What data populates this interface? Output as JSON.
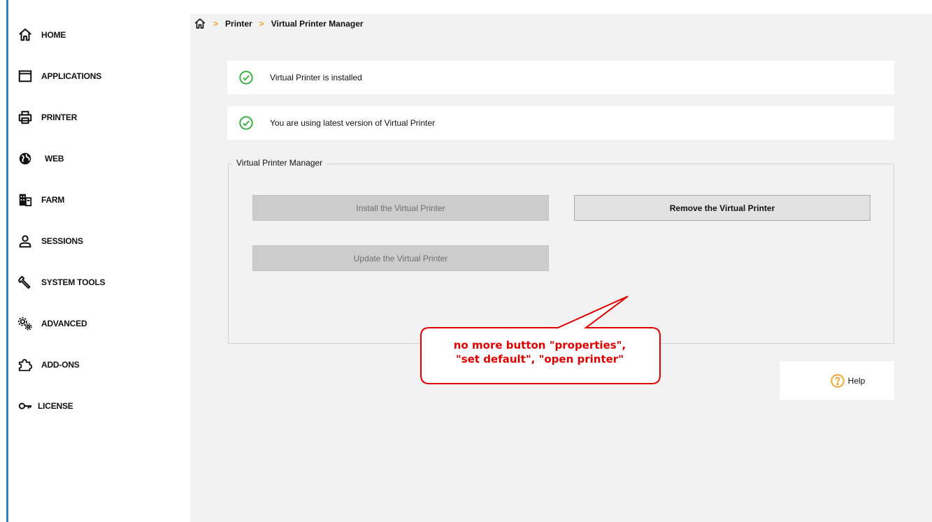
{
  "sidebar": {
    "items": [
      {
        "label": "HOME",
        "icon": "home-icon"
      },
      {
        "label": "APPLICATIONS",
        "icon": "window-icon"
      },
      {
        "label": "PRINTER",
        "icon": "printer-icon"
      },
      {
        "label": "WEB",
        "icon": "globe-icon"
      },
      {
        "label": "FARM",
        "icon": "building-icon"
      },
      {
        "label": "SESSIONS",
        "icon": "user-icon"
      },
      {
        "label": "SYSTEM TOOLS",
        "icon": "wrench-icon"
      },
      {
        "label": "ADVANCED",
        "icon": "gears-icon"
      },
      {
        "label": "ADD-ONS",
        "icon": "puzzle-icon"
      },
      {
        "label": "LICENSE",
        "icon": "key-icon"
      }
    ]
  },
  "breadcrumb": {
    "items": [
      "Printer",
      "Virtual Printer Manager"
    ]
  },
  "status": {
    "installed": "Virtual Printer is installed",
    "latest": "You are using latest version of Virtual Printer"
  },
  "manager": {
    "title": "Virtual Printer Manager",
    "install_label": "Install the Virtual Printer",
    "remove_label": "Remove the Virtual Printer",
    "update_label": "Update the Virtual Printer"
  },
  "annotation": {
    "line1": "no more button \"properties\",",
    "line2": "\"set default\", \"open printer\""
  },
  "help": {
    "label": "Help"
  },
  "colors": {
    "accent": "#2d7fc6",
    "ok_green": "#3cb043",
    "breadcrumb_separator": "#f0a020",
    "annotation_red": "#e00000",
    "help_orange": "#f0a020"
  }
}
